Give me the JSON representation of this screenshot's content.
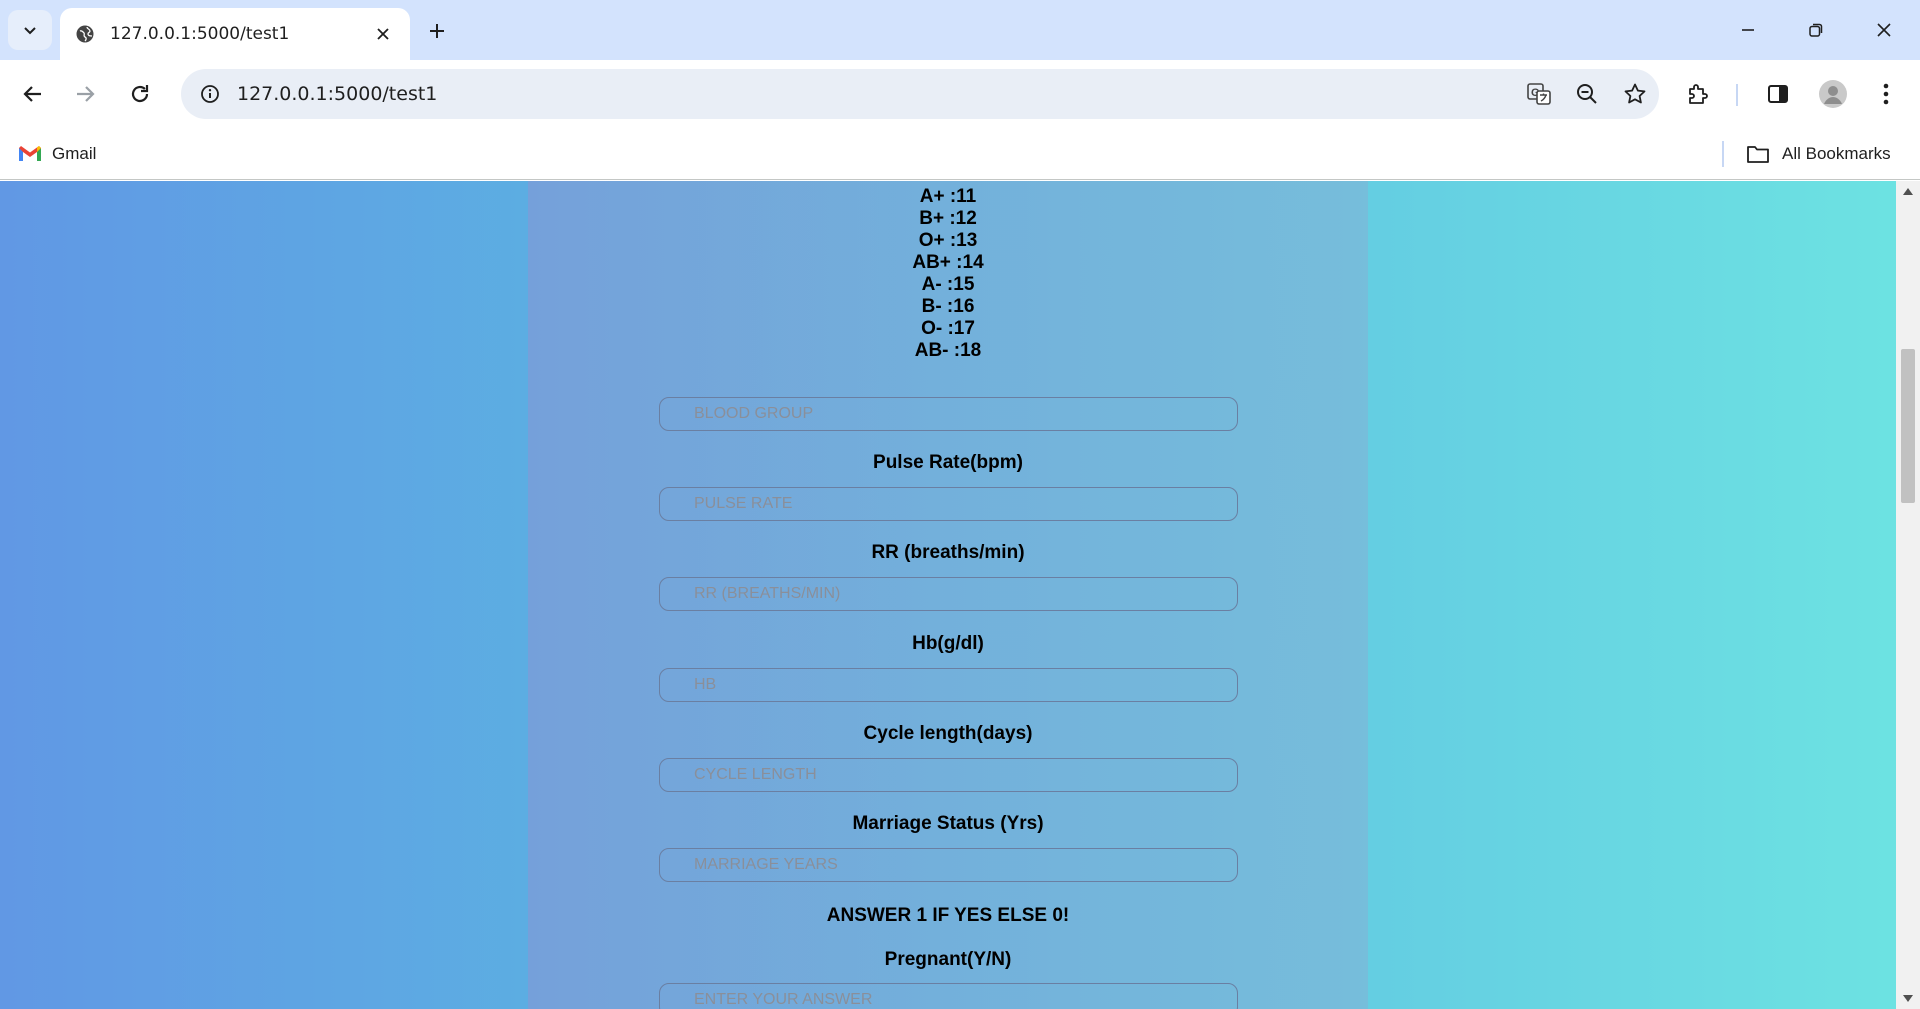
{
  "browser": {
    "tab_title": "127.0.0.1:5000/test1",
    "url": "127.0.0.1:5000/test1",
    "bookmarks": {
      "gmail": "Gmail",
      "all_bookmarks": "All Bookmarks"
    }
  },
  "page": {
    "blood_group_codes": [
      "A+ :11",
      "B+ :12",
      "O+ :13",
      "AB+ :14",
      "A- :15",
      "B- :16",
      "O- :17",
      "AB- :18"
    ],
    "fields": {
      "blood_group": {
        "placeholder": "BLOOD GROUP"
      },
      "pulse_rate": {
        "label": "Pulse Rate(bpm)",
        "placeholder": "PULSE RATE"
      },
      "rr": {
        "label": "RR (breaths/min)",
        "placeholder": "RR (BREATHS/MIN)"
      },
      "hb": {
        "label": "Hb(g/dl)",
        "placeholder": "HB"
      },
      "cycle_length": {
        "label": "Cycle length(days)",
        "placeholder": "CYCLE LENGTH"
      },
      "marriage": {
        "label": "Marriage Status (Yrs)",
        "placeholder": "MARRIAGE YEARS"
      },
      "pregnant": {
        "label": "Pregnant(Y/N)",
        "placeholder": "ENTER YOUR ANSWER"
      }
    },
    "note": "ANSWER 1 IF YES ELSE 0!"
  }
}
